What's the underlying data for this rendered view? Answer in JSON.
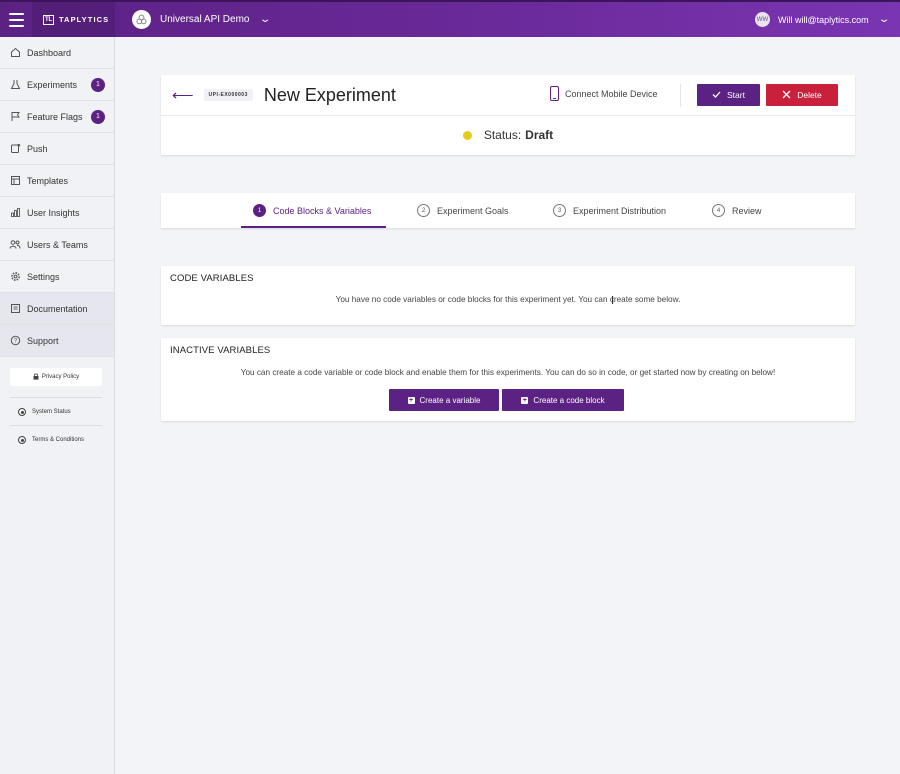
{
  "app": {
    "brand_mark": "TL",
    "brand_name": "TAPLYTICS"
  },
  "topbar": {
    "project_name": "Universal API Demo",
    "user_initials": "WW",
    "user_label": "Will will@taplytics.com"
  },
  "sidebar": {
    "items": [
      {
        "label": "Dashboard",
        "icon": "home-icon"
      },
      {
        "label": "Experiments",
        "icon": "flask-icon",
        "badge": "1"
      },
      {
        "label": "Feature Flags",
        "icon": "flag-icon",
        "badge": "1"
      },
      {
        "label": "Push",
        "icon": "push-icon"
      },
      {
        "label": "Templates",
        "icon": "template-icon"
      },
      {
        "label": "User Insights",
        "icon": "bar-chart-icon"
      },
      {
        "label": "Users & Teams",
        "icon": "users-icon"
      },
      {
        "label": "Settings",
        "icon": "gear-icon"
      },
      {
        "label": "Documentation",
        "icon": "document-icon"
      },
      {
        "label": "Support",
        "icon": "help-icon"
      }
    ],
    "privacy_label": "Privacy Policy",
    "system_status_label": "System Status",
    "terms_label": "Terms & Conditions"
  },
  "experiment": {
    "id": "UPI-EX000003",
    "title": "New Experiment",
    "connect_label": "Connect Mobile Device",
    "start_label": "Start",
    "delete_label": "Delete",
    "status_label": "Status:",
    "status_value": "Draft",
    "status_color": "#e5cc16"
  },
  "tabs": [
    {
      "num": "1",
      "label": "Code Blocks & Variables",
      "active": true
    },
    {
      "num": "2",
      "label": "Experiment Goals"
    },
    {
      "num": "3",
      "label": "Experiment Distribution"
    },
    {
      "num": "4",
      "label": "Review"
    }
  ],
  "code_variables": {
    "title": "CODE VARIABLES",
    "message": "You have no code variables or code blocks for this experiment yet.  You can create some below."
  },
  "inactive_variables": {
    "title": "INACTIVE VARIABLES",
    "message": "You can create a code variable or code block and enable them for this experiments. You can do so in code, or get started now by creating on below!",
    "create_variable_label": "Create a variable",
    "create_block_label": "Create a code block"
  },
  "colors": {
    "brand": "#5b2183",
    "delete": "#c9203b"
  }
}
